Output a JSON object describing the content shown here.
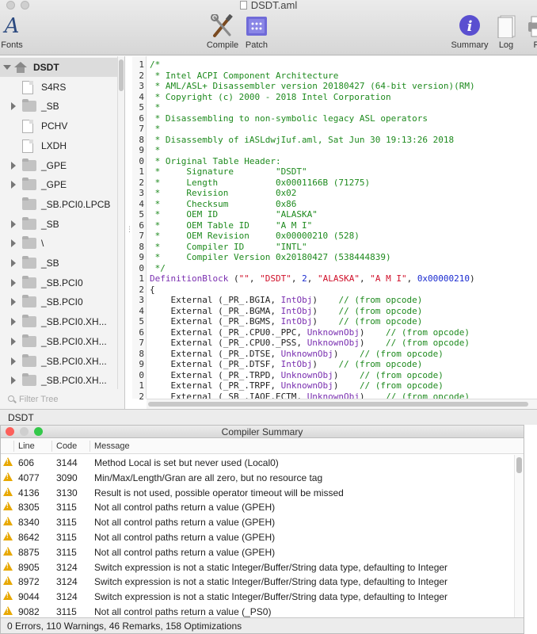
{
  "window": {
    "title": "DSDT.aml"
  },
  "toolbar": {
    "fonts_label": "Fonts",
    "compile_label": "Compile",
    "patch_label": "Patch",
    "summary_label": "Summary",
    "log_label": "Log",
    "print_label": "Pr",
    "accent": "#5a4fd0"
  },
  "sidebar": {
    "items": [
      {
        "label": "DSDT",
        "icon": "house-icon",
        "expander": "expanded"
      },
      {
        "label": "S4RS",
        "icon": "document-icon",
        "expander": "none"
      },
      {
        "label": "_SB",
        "icon": "folder-icon",
        "expander": "collapsed"
      },
      {
        "label": "PCHV",
        "icon": "document-icon",
        "expander": "none"
      },
      {
        "label": "LXDH",
        "icon": "document-icon",
        "expander": "none"
      },
      {
        "label": "_GPE",
        "icon": "folder-icon",
        "expander": "collapsed"
      },
      {
        "label": "_GPE",
        "icon": "folder-icon",
        "expander": "collapsed"
      },
      {
        "label": "_SB.PCI0.LPCB",
        "icon": "folder-icon",
        "expander": "none"
      },
      {
        "label": "_SB",
        "icon": "folder-icon",
        "expander": "collapsed"
      },
      {
        "label": "\\",
        "icon": "folder-icon",
        "expander": "collapsed"
      },
      {
        "label": "_SB",
        "icon": "folder-icon",
        "expander": "collapsed"
      },
      {
        "label": "_SB.PCI0",
        "icon": "folder-icon",
        "expander": "collapsed"
      },
      {
        "label": "_SB.PCI0",
        "icon": "folder-icon",
        "expander": "collapsed"
      },
      {
        "label": "_SB.PCI0.XH...",
        "icon": "folder-icon",
        "expander": "collapsed"
      },
      {
        "label": "_SB.PCI0.XH...",
        "icon": "folder-icon",
        "expander": "collapsed"
      },
      {
        "label": "_SB.PCI0.XH...",
        "icon": "folder-icon",
        "expander": "collapsed"
      },
      {
        "label": "_SB.PCI0.XH...",
        "icon": "folder-icon",
        "expander": "collapsed"
      }
    ],
    "filter_placeholder": "Filter Tree"
  },
  "editor": {
    "lines": [
      {
        "n": "1",
        "parts": [
          [
            "cmt",
            "/*"
          ]
        ]
      },
      {
        "n": "2",
        "parts": [
          [
            "cmt",
            " * Intel ACPI Component Architecture"
          ]
        ]
      },
      {
        "n": "3",
        "parts": [
          [
            "cmt",
            " * AML/ASL+ Disassembler version 20180427 (64-bit version)(RM)"
          ]
        ]
      },
      {
        "n": "4",
        "parts": [
          [
            "cmt",
            " * Copyright (c) 2000 - 2018 Intel Corporation"
          ]
        ]
      },
      {
        "n": "5",
        "parts": [
          [
            "cmt",
            " *"
          ]
        ]
      },
      {
        "n": "6",
        "parts": [
          [
            "cmt",
            " * Disassembling to non-symbolic legacy ASL operators"
          ]
        ]
      },
      {
        "n": "7",
        "parts": [
          [
            "cmt",
            " *"
          ]
        ]
      },
      {
        "n": "8",
        "parts": [
          [
            "cmt",
            " * Disassembly of iASLdwjIuf.aml, Sat Jun 30 19:13:26 2018"
          ]
        ]
      },
      {
        "n": "9",
        "parts": [
          [
            "cmt",
            " *"
          ]
        ]
      },
      {
        "n": "0",
        "parts": [
          [
            "cmt",
            " * Original Table Header:"
          ]
        ]
      },
      {
        "n": "1",
        "parts": [
          [
            "cmt",
            " *     Signature        \"DSDT\""
          ]
        ]
      },
      {
        "n": "2",
        "parts": [
          [
            "cmt",
            " *     Length           0x0001166B (71275)"
          ]
        ]
      },
      {
        "n": "3",
        "parts": [
          [
            "cmt",
            " *     Revision         0x02"
          ]
        ]
      },
      {
        "n": "4",
        "parts": [
          [
            "cmt",
            " *     Checksum         0x86"
          ]
        ]
      },
      {
        "n": "5",
        "parts": [
          [
            "cmt",
            " *     OEM ID           \"ALASKA\""
          ]
        ]
      },
      {
        "n": "6",
        "parts": [
          [
            "cmt",
            " *     OEM Table ID     \"A M I\""
          ]
        ]
      },
      {
        "n": "7",
        "parts": [
          [
            "cmt",
            " *     OEM Revision     0x00000210 (528)"
          ]
        ]
      },
      {
        "n": "8",
        "parts": [
          [
            "cmt",
            " *     Compiler ID      \"INTL\""
          ]
        ]
      },
      {
        "n": "9",
        "parts": [
          [
            "cmt",
            " *     Compiler Version 0x20180427 (538444839)"
          ]
        ]
      },
      {
        "n": "0",
        "parts": [
          [
            "cmt",
            " */"
          ]
        ]
      },
      {
        "n": "1",
        "parts": [
          [
            "kw",
            "DefinitionBlock"
          ],
          [
            "plain",
            " ("
          ],
          [
            "str",
            "\"\""
          ],
          [
            "plain",
            ", "
          ],
          [
            "str",
            "\"DSDT\""
          ],
          [
            "plain",
            ", "
          ],
          [
            "num",
            "2"
          ],
          [
            "plain",
            ", "
          ],
          [
            "str",
            "\"ALASKA\""
          ],
          [
            "plain",
            ", "
          ],
          [
            "str",
            "\"A M I\""
          ],
          [
            "plain",
            ", "
          ],
          [
            "num",
            "0x00000210"
          ],
          [
            "plain",
            ")"
          ]
        ]
      },
      {
        "n": "2",
        "parts": [
          [
            "plain",
            "{"
          ]
        ]
      },
      {
        "n": "3",
        "parts": [
          [
            "plain",
            "    External (_PR_.BGIA, "
          ],
          [
            "kw",
            "IntObj"
          ],
          [
            "plain",
            ")    "
          ],
          [
            "cmt",
            "// (from opcode)"
          ]
        ]
      },
      {
        "n": "4",
        "parts": [
          [
            "plain",
            "    External (_PR_.BGMA, "
          ],
          [
            "kw",
            "IntObj"
          ],
          [
            "plain",
            ")    "
          ],
          [
            "cmt",
            "// (from opcode)"
          ]
        ]
      },
      {
        "n": "5",
        "parts": [
          [
            "plain",
            "    External (_PR_.BGMS, "
          ],
          [
            "kw",
            "IntObj"
          ],
          [
            "plain",
            ")    "
          ],
          [
            "cmt",
            "// (from opcode)"
          ]
        ]
      },
      {
        "n": "6",
        "parts": [
          [
            "plain",
            "    External (_PR_.CPU0._PPC, "
          ],
          [
            "kw",
            "UnknownObj"
          ],
          [
            "plain",
            ")    "
          ],
          [
            "cmt",
            "// (from opcode)"
          ]
        ]
      },
      {
        "n": "7",
        "parts": [
          [
            "plain",
            "    External (_PR_.CPU0._PSS, "
          ],
          [
            "kw",
            "UnknownObj"
          ],
          [
            "plain",
            ")    "
          ],
          [
            "cmt",
            "// (from opcode)"
          ]
        ]
      },
      {
        "n": "8",
        "parts": [
          [
            "plain",
            "    External (_PR_.DTSE, "
          ],
          [
            "kw",
            "UnknownObj"
          ],
          [
            "plain",
            ")    "
          ],
          [
            "cmt",
            "// (from opcode)"
          ]
        ]
      },
      {
        "n": "9",
        "parts": [
          [
            "plain",
            "    External (_PR_.DTSF, "
          ],
          [
            "kw",
            "IntObj"
          ],
          [
            "plain",
            ")    "
          ],
          [
            "cmt",
            "// (from opcode)"
          ]
        ]
      },
      {
        "n": "0",
        "parts": [
          [
            "plain",
            "    External (_PR_.TRPD, "
          ],
          [
            "kw",
            "UnknownObj"
          ],
          [
            "plain",
            ")    "
          ],
          [
            "cmt",
            "// (from opcode)"
          ]
        ]
      },
      {
        "n": "1",
        "parts": [
          [
            "plain",
            "    External (_PR_.TRPF, "
          ],
          [
            "kw",
            "UnknownObj"
          ],
          [
            "plain",
            ")    "
          ],
          [
            "cmt",
            "// (from opcode)"
          ]
        ]
      },
      {
        "n": "2",
        "parts": [
          [
            "plain",
            "    External (_SB_.IAOE.ECTM, "
          ],
          [
            "kw",
            "UnknownObj"
          ],
          [
            "plain",
            ")    "
          ],
          [
            "cmt",
            "// (from opcode)"
          ]
        ]
      }
    ]
  },
  "status_strip": {
    "text": "DSDT"
  },
  "summary": {
    "title": "Compiler Summary",
    "columns": {
      "line": "Line",
      "code": "Code",
      "message": "Message"
    },
    "rows": [
      {
        "line": "606",
        "code": "3144",
        "message": "Method Local is set but never used (Local0)"
      },
      {
        "line": "4077",
        "code": "3090",
        "message": "Min/Max/Length/Gran are all zero, but no resource tag"
      },
      {
        "line": "4136",
        "code": "3130",
        "message": "Result is not used, possible operator timeout will be missed"
      },
      {
        "line": "8305",
        "code": "3115",
        "message": "Not all control paths return a value (GPEH)"
      },
      {
        "line": "8340",
        "code": "3115",
        "message": "Not all control paths return a value (GPEH)"
      },
      {
        "line": "8642",
        "code": "3115",
        "message": "Not all control paths return a value (GPEH)"
      },
      {
        "line": "8875",
        "code": "3115",
        "message": "Not all control paths return a value (GPEH)"
      },
      {
        "line": "8905",
        "code": "3124",
        "message": "Switch expression is not a static Integer/Buffer/String data type, defaulting to Integer"
      },
      {
        "line": "8972",
        "code": "3124",
        "message": "Switch expression is not a static Integer/Buffer/String data type, defaulting to Integer"
      },
      {
        "line": "9044",
        "code": "3124",
        "message": "Switch expression is not a static Integer/Buffer/String data type, defaulting to Integer"
      },
      {
        "line": "9082",
        "code": "3115",
        "message": "Not all control paths return a value (_PS0)"
      }
    ],
    "footer": "0 Errors, 110 Warnings, 46 Remarks, 158 Optimizations",
    "colors": {
      "close": "#fc605b",
      "minimize": "#cfcfcf",
      "zoom": "#34c84a",
      "warning": "#e8a800"
    }
  }
}
